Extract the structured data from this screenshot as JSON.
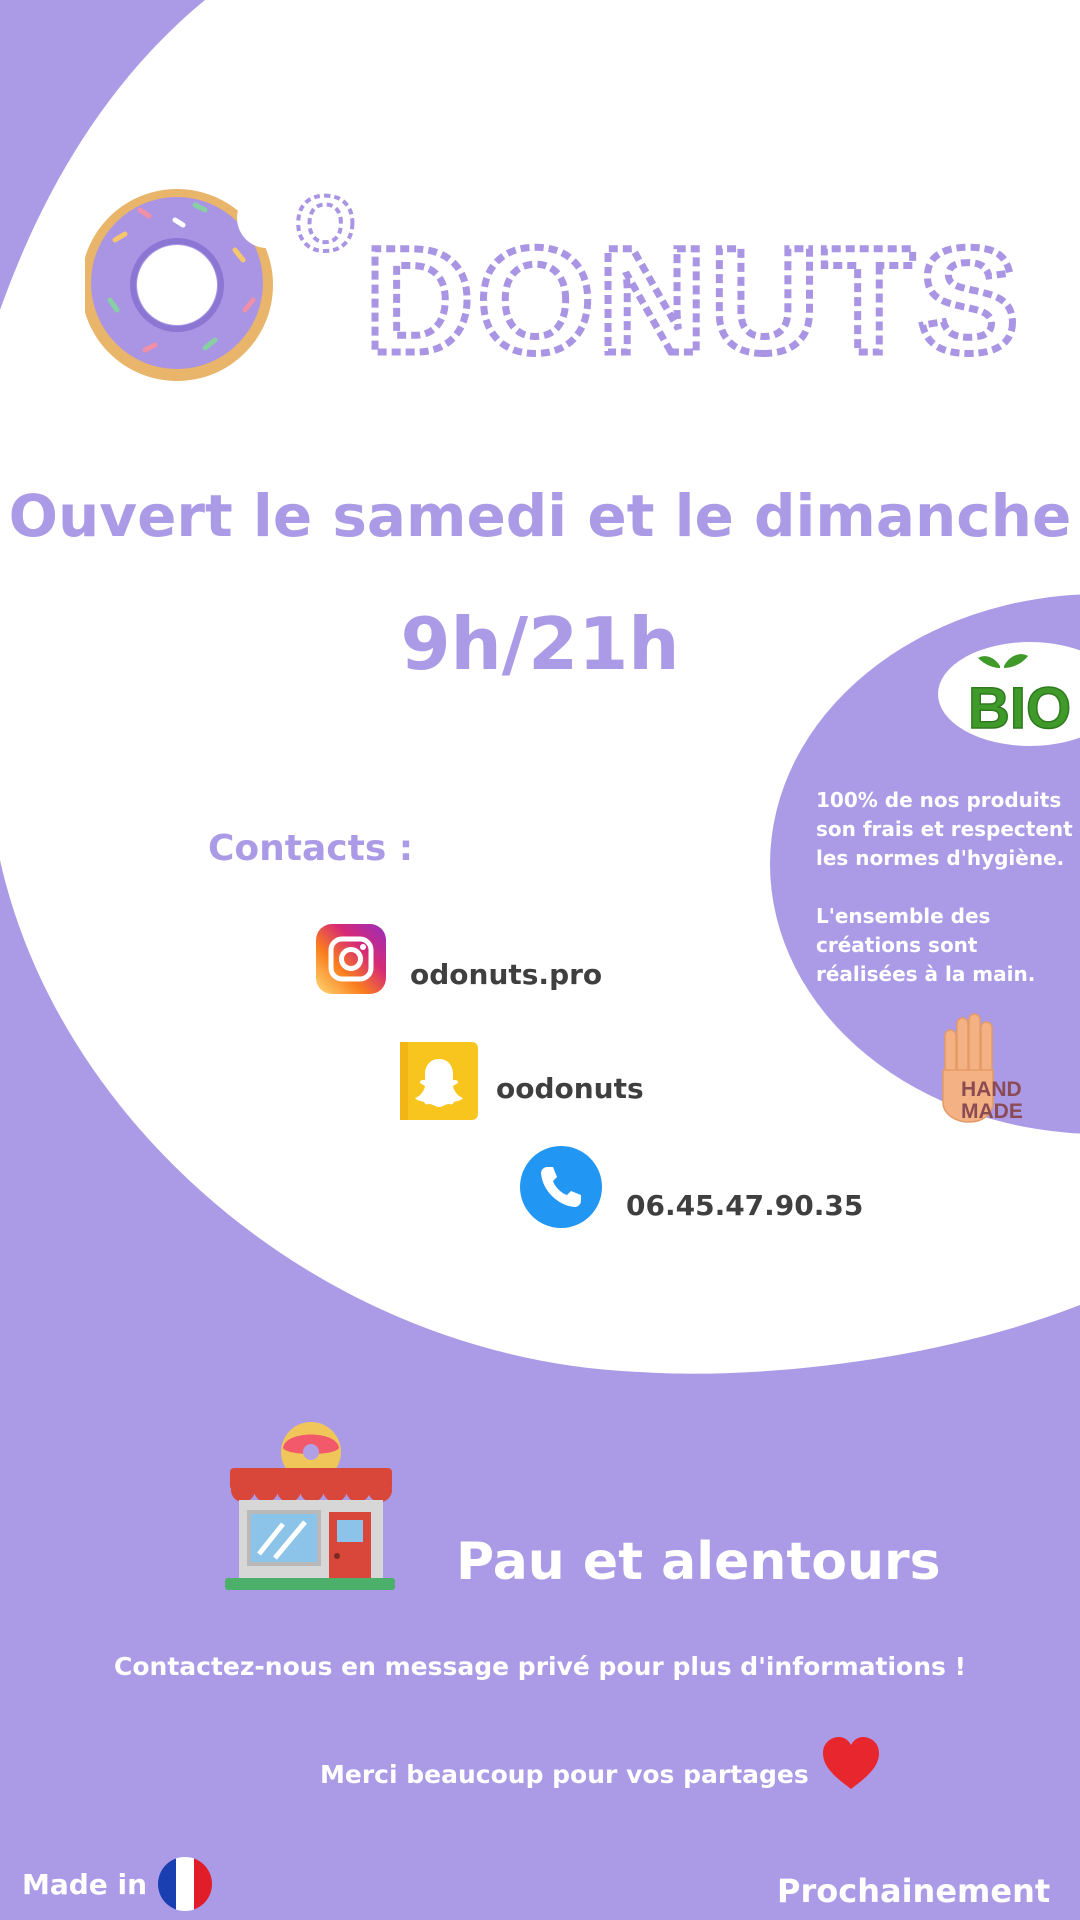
{
  "brand": {
    "name": "DONUTS",
    "prefix": "O",
    "colors": {
      "lilac": "#ab9be6",
      "white": "#ffffff",
      "dark_text": "#3f3f3f",
      "bio_green": "#3f9a2a"
    }
  },
  "hours": {
    "days": "Ouvert le samedi et le dimanche",
    "time": "9h/21h"
  },
  "contacts": {
    "title": "Contacts :",
    "items": [
      {
        "icon": "instagram-icon",
        "label": "odonuts.pro"
      },
      {
        "icon": "snapchat-icon",
        "label": "oodonuts"
      },
      {
        "icon": "phone-icon",
        "label": "06.45.47.90.35"
      }
    ]
  },
  "info": {
    "badge": "BIO",
    "paragraph_1": "100% de nos produits son frais et respectent les normes d'hygiène.",
    "paragraph_2": "L'ensemble des créations sont réalisées à la main.",
    "handmade_line_1": "HAND",
    "handmade_line_2": "MADE"
  },
  "area": {
    "icon": "donut-shop-icon",
    "title": "Pau et alentours"
  },
  "messages": {
    "contact": "Contactez-nous en message privé pour plus d'informations !",
    "thanks": "Merci beaucoup pour vos partages",
    "made_in": "Made in",
    "coming_soon": "Prochainement ..."
  }
}
